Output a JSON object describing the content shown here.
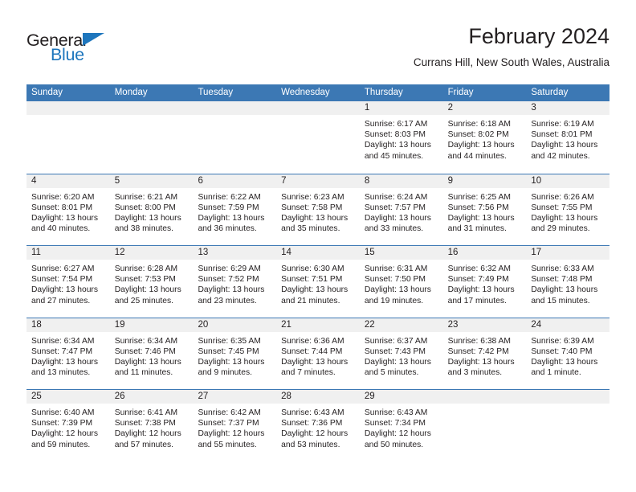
{
  "brand": {
    "name_part1": "General",
    "name_part2": "Blue",
    "accent_color": "#1e76bd"
  },
  "header": {
    "title": "February 2024",
    "subtitle": "Currans Hill, New South Wales, Australia"
  },
  "calendar": {
    "header_color": "#3c78b4",
    "daynum_band_color": "#f0f0f0",
    "weekday_labels": [
      "Sunday",
      "Monday",
      "Tuesday",
      "Wednesday",
      "Thursday",
      "Friday",
      "Saturday"
    ],
    "weeks": [
      [
        {
          "day": "",
          "sunrise": "",
          "sunset": "",
          "daylight": ""
        },
        {
          "day": "",
          "sunrise": "",
          "sunset": "",
          "daylight": ""
        },
        {
          "day": "",
          "sunrise": "",
          "sunset": "",
          "daylight": ""
        },
        {
          "day": "",
          "sunrise": "",
          "sunset": "",
          "daylight": ""
        },
        {
          "day": "1",
          "sunrise": "Sunrise: 6:17 AM",
          "sunset": "Sunset: 8:03 PM",
          "daylight": "Daylight: 13 hours and 45 minutes."
        },
        {
          "day": "2",
          "sunrise": "Sunrise: 6:18 AM",
          "sunset": "Sunset: 8:02 PM",
          "daylight": "Daylight: 13 hours and 44 minutes."
        },
        {
          "day": "3",
          "sunrise": "Sunrise: 6:19 AM",
          "sunset": "Sunset: 8:01 PM",
          "daylight": "Daylight: 13 hours and 42 minutes."
        }
      ],
      [
        {
          "day": "4",
          "sunrise": "Sunrise: 6:20 AM",
          "sunset": "Sunset: 8:01 PM",
          "daylight": "Daylight: 13 hours and 40 minutes."
        },
        {
          "day": "5",
          "sunrise": "Sunrise: 6:21 AM",
          "sunset": "Sunset: 8:00 PM",
          "daylight": "Daylight: 13 hours and 38 minutes."
        },
        {
          "day": "6",
          "sunrise": "Sunrise: 6:22 AM",
          "sunset": "Sunset: 7:59 PM",
          "daylight": "Daylight: 13 hours and 36 minutes."
        },
        {
          "day": "7",
          "sunrise": "Sunrise: 6:23 AM",
          "sunset": "Sunset: 7:58 PM",
          "daylight": "Daylight: 13 hours and 35 minutes."
        },
        {
          "day": "8",
          "sunrise": "Sunrise: 6:24 AM",
          "sunset": "Sunset: 7:57 PM",
          "daylight": "Daylight: 13 hours and 33 minutes."
        },
        {
          "day": "9",
          "sunrise": "Sunrise: 6:25 AM",
          "sunset": "Sunset: 7:56 PM",
          "daylight": "Daylight: 13 hours and 31 minutes."
        },
        {
          "day": "10",
          "sunrise": "Sunrise: 6:26 AM",
          "sunset": "Sunset: 7:55 PM",
          "daylight": "Daylight: 13 hours and 29 minutes."
        }
      ],
      [
        {
          "day": "11",
          "sunrise": "Sunrise: 6:27 AM",
          "sunset": "Sunset: 7:54 PM",
          "daylight": "Daylight: 13 hours and 27 minutes."
        },
        {
          "day": "12",
          "sunrise": "Sunrise: 6:28 AM",
          "sunset": "Sunset: 7:53 PM",
          "daylight": "Daylight: 13 hours and 25 minutes."
        },
        {
          "day": "13",
          "sunrise": "Sunrise: 6:29 AM",
          "sunset": "Sunset: 7:52 PM",
          "daylight": "Daylight: 13 hours and 23 minutes."
        },
        {
          "day": "14",
          "sunrise": "Sunrise: 6:30 AM",
          "sunset": "Sunset: 7:51 PM",
          "daylight": "Daylight: 13 hours and 21 minutes."
        },
        {
          "day": "15",
          "sunrise": "Sunrise: 6:31 AM",
          "sunset": "Sunset: 7:50 PM",
          "daylight": "Daylight: 13 hours and 19 minutes."
        },
        {
          "day": "16",
          "sunrise": "Sunrise: 6:32 AM",
          "sunset": "Sunset: 7:49 PM",
          "daylight": "Daylight: 13 hours and 17 minutes."
        },
        {
          "day": "17",
          "sunrise": "Sunrise: 6:33 AM",
          "sunset": "Sunset: 7:48 PM",
          "daylight": "Daylight: 13 hours and 15 minutes."
        }
      ],
      [
        {
          "day": "18",
          "sunrise": "Sunrise: 6:34 AM",
          "sunset": "Sunset: 7:47 PM",
          "daylight": "Daylight: 13 hours and 13 minutes."
        },
        {
          "day": "19",
          "sunrise": "Sunrise: 6:34 AM",
          "sunset": "Sunset: 7:46 PM",
          "daylight": "Daylight: 13 hours and 11 minutes."
        },
        {
          "day": "20",
          "sunrise": "Sunrise: 6:35 AM",
          "sunset": "Sunset: 7:45 PM",
          "daylight": "Daylight: 13 hours and 9 minutes."
        },
        {
          "day": "21",
          "sunrise": "Sunrise: 6:36 AM",
          "sunset": "Sunset: 7:44 PM",
          "daylight": "Daylight: 13 hours and 7 minutes."
        },
        {
          "day": "22",
          "sunrise": "Sunrise: 6:37 AM",
          "sunset": "Sunset: 7:43 PM",
          "daylight": "Daylight: 13 hours and 5 minutes."
        },
        {
          "day": "23",
          "sunrise": "Sunrise: 6:38 AM",
          "sunset": "Sunset: 7:42 PM",
          "daylight": "Daylight: 13 hours and 3 minutes."
        },
        {
          "day": "24",
          "sunrise": "Sunrise: 6:39 AM",
          "sunset": "Sunset: 7:40 PM",
          "daylight": "Daylight: 13 hours and 1 minute."
        }
      ],
      [
        {
          "day": "25",
          "sunrise": "Sunrise: 6:40 AM",
          "sunset": "Sunset: 7:39 PM",
          "daylight": "Daylight: 12 hours and 59 minutes."
        },
        {
          "day": "26",
          "sunrise": "Sunrise: 6:41 AM",
          "sunset": "Sunset: 7:38 PM",
          "daylight": "Daylight: 12 hours and 57 minutes."
        },
        {
          "day": "27",
          "sunrise": "Sunrise: 6:42 AM",
          "sunset": "Sunset: 7:37 PM",
          "daylight": "Daylight: 12 hours and 55 minutes."
        },
        {
          "day": "28",
          "sunrise": "Sunrise: 6:43 AM",
          "sunset": "Sunset: 7:36 PM",
          "daylight": "Daylight: 12 hours and 53 minutes."
        },
        {
          "day": "29",
          "sunrise": "Sunrise: 6:43 AM",
          "sunset": "Sunset: 7:34 PM",
          "daylight": "Daylight: 12 hours and 50 minutes."
        },
        {
          "day": "",
          "sunrise": "",
          "sunset": "",
          "daylight": ""
        },
        {
          "day": "",
          "sunrise": "",
          "sunset": "",
          "daylight": ""
        }
      ]
    ]
  }
}
